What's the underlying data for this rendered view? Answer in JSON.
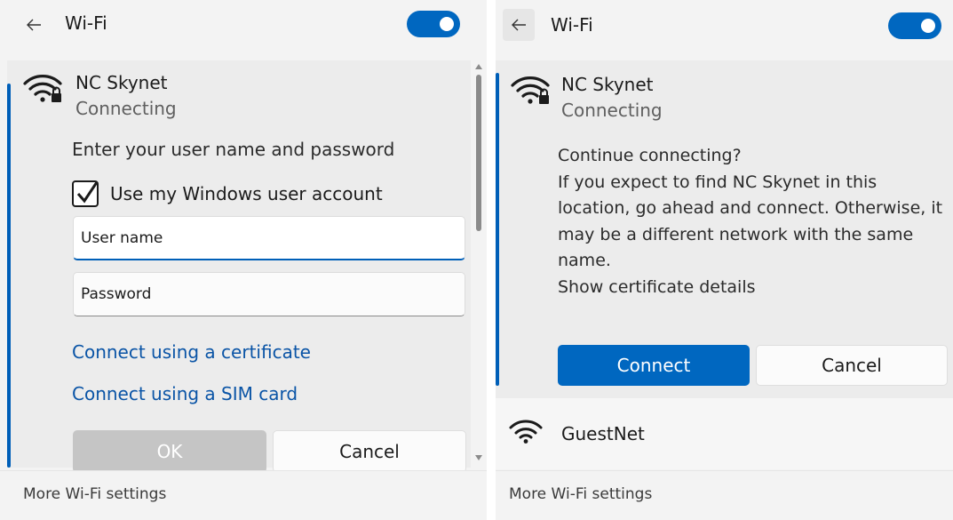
{
  "left": {
    "header": {
      "title": "Wi-Fi"
    },
    "network": {
      "name": "NC Skynet",
      "status": "Connecting"
    },
    "prompt": "Enter your user name and password",
    "checkbox": {
      "label": "Use my Windows user account",
      "checked": true
    },
    "fields": {
      "username": {
        "placeholder": "User name"
      },
      "password": {
        "placeholder": "Password"
      }
    },
    "links": {
      "certificate": "Connect using a certificate",
      "sim": "Connect using a SIM card"
    },
    "buttons": {
      "ok": "OK",
      "cancel": "Cancel"
    },
    "footer": {
      "text": "More Wi-Fi settings"
    }
  },
  "right": {
    "header": {
      "title": "Wi-Fi"
    },
    "network": {
      "name": "NC Skynet",
      "status": "Connecting"
    },
    "message": {
      "lines": [
        "Continue connecting?",
        "If you expect to find NC Skynet in this",
        "location, go ahead and connect. Otherwise, it",
        "may be a different network with the same",
        "name.",
        "Show certificate details"
      ]
    },
    "buttons": {
      "connect": "Connect",
      "cancel": "Cancel"
    },
    "other_network": {
      "name": "GuestNet"
    },
    "footer": {
      "text": "More Wi-Fi settings"
    }
  },
  "colors": {
    "accent": "#0067c0",
    "link": "#0a54a6",
    "background": "#f3f3f3"
  },
  "icons": [
    "back-arrow-icon",
    "wifi-secured-icon",
    "wifi-icon",
    "checkmark-icon",
    "scroll-up-icon",
    "scroll-down-icon"
  ]
}
